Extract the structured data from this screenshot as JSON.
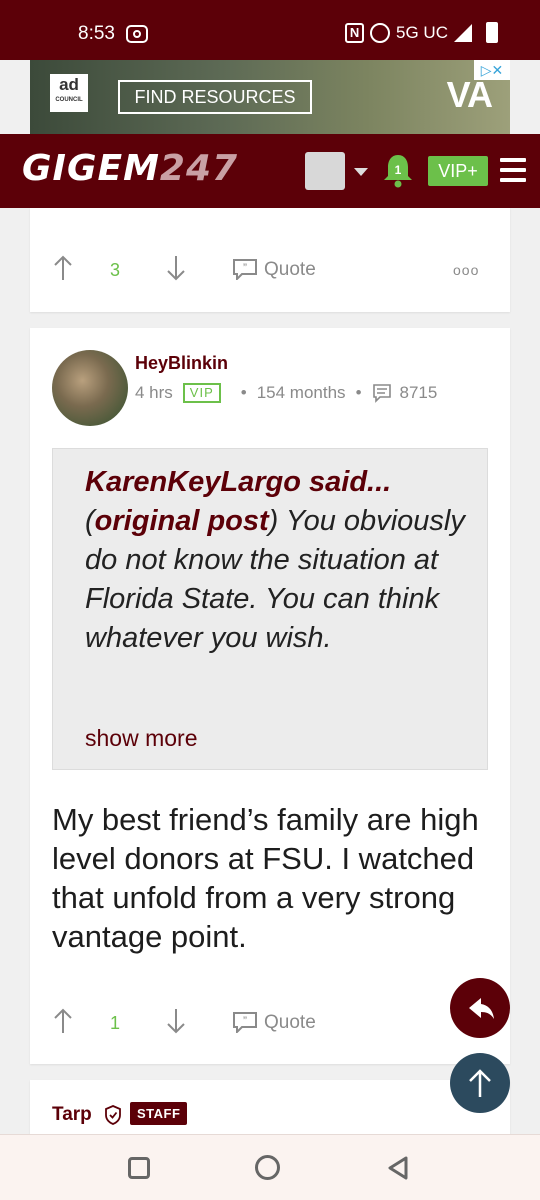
{
  "status_bar": {
    "time": "8:53",
    "network": "5G UC"
  },
  "ad": {
    "logo_text": "ad",
    "logo_sub": "COUNCIL",
    "button": "FIND RESOURCES",
    "brand": "VA"
  },
  "header": {
    "logo_main": "GIGEM",
    "logo_num": "247",
    "notification_count": "1",
    "vip_label": "VIP+"
  },
  "posts": [
    {
      "upvotes": "3",
      "quote_label": "Quote"
    },
    {
      "username": "HeyBlinkin",
      "age": "4 hrs",
      "vip_badge": "VIP",
      "membership": "154 months",
      "post_count": "8715",
      "quote_author": "KarenKeyLargo said...",
      "quote_link": "original post",
      "quote_body": "You obviously do not know the situation at Florida State. You can think whatever you wish.",
      "show_more": "show more",
      "body": "My best friend’s family are high level donors at FSU. I watched that unfold from a very strong vantage point.",
      "upvotes": "1",
      "quote_label": "Quote"
    },
    {
      "username": "Tarp",
      "staff_badge": "STAFF"
    }
  ],
  "colors": {
    "brand": "#5c0008",
    "accent_green": "#6cc04a",
    "scroll_top": "#2c4a5e"
  }
}
